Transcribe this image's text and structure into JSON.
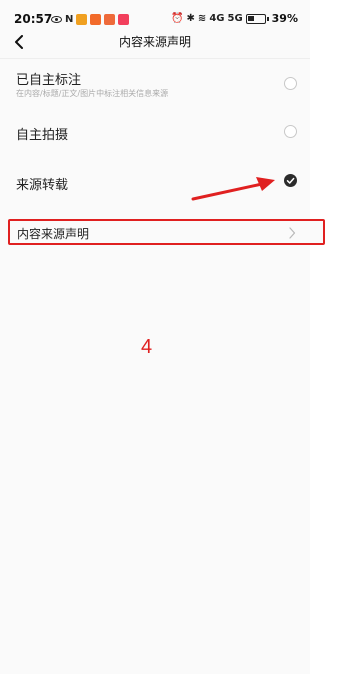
{
  "status_bar": {
    "time": "20:57",
    "n_label": "N",
    "network_labels": [
      "4G",
      "5G"
    ],
    "battery_percent": "39%"
  },
  "header": {
    "title": "内容来源声明",
    "back_icon": "chevron-left-icon"
  },
  "options": [
    {
      "title": "已自主标注",
      "subtitle": "在内容/标题/正文/图片中标注相关信息来源",
      "selected": false
    },
    {
      "title": "自主拍摄",
      "subtitle": "",
      "selected": false
    },
    {
      "title": "来源转载",
      "subtitle": "",
      "selected": true
    }
  ],
  "declaration_row": {
    "label": "内容来源声明",
    "icon": "chevron-right-icon"
  },
  "annotation": {
    "step_number": "4",
    "color": "#e02020"
  },
  "colors": {
    "accent_dark": "#2b2b2b",
    "highlight_red": "#e02020"
  }
}
